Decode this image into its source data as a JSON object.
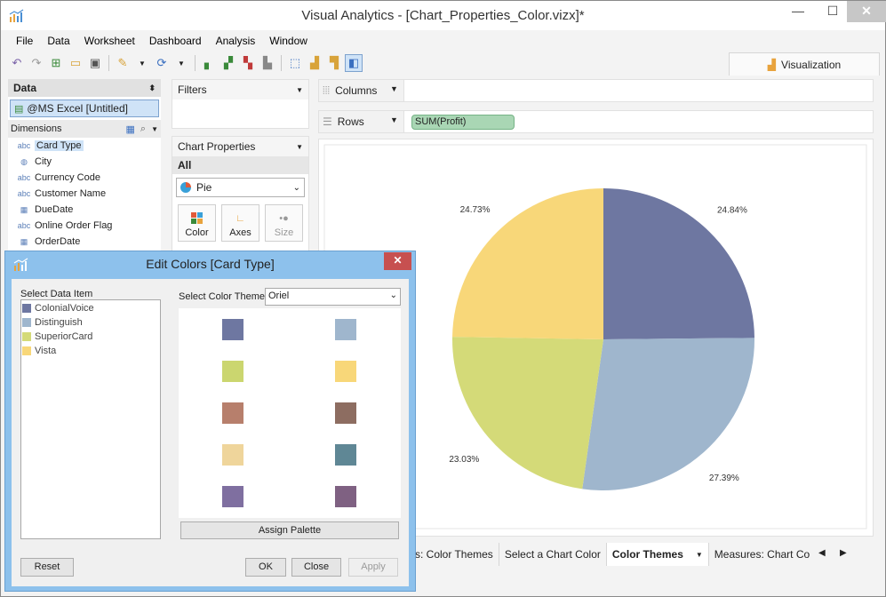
{
  "window": {
    "title": "Visual Analytics - [Chart_Properties_Color.vizx]*"
  },
  "menu": [
    "File",
    "Data",
    "Worksheet",
    "Dashboard",
    "Analysis",
    "Window"
  ],
  "visualization_tab": "Visualization",
  "data_pane": {
    "header": "Data",
    "datasource": "@MS Excel [Untitled]",
    "dimensions_label": "Dimensions",
    "dimensions": [
      {
        "type": "abc",
        "label": "Card Type",
        "selected": true
      },
      {
        "type": "globe",
        "label": "City"
      },
      {
        "type": "abc",
        "label": "Currency Code"
      },
      {
        "type": "abc",
        "label": "Customer Name"
      },
      {
        "type": "date",
        "label": "DueDate"
      },
      {
        "type": "abc",
        "label": "Online Order Flag"
      },
      {
        "type": "date",
        "label": "OrderDate"
      }
    ],
    "type_glyphs": {
      "abc": "abc",
      "globe": "◍",
      "date": "▦"
    }
  },
  "filters": {
    "label": "Filters"
  },
  "chart_properties": {
    "label": "Chart Properties",
    "all": "All",
    "chart_type": "Pie",
    "buttons": [
      "Color",
      "Axes",
      "Size"
    ]
  },
  "shelves": {
    "columns_label": "Columns",
    "rows_label": "Rows",
    "rows_pill": "SUM(Profit)"
  },
  "chart_data": {
    "type": "pie",
    "categories": [
      "ColonialVoice",
      "Distinguish",
      "SuperiorCard",
      "Vista"
    ],
    "values": [
      24.84,
      27.39,
      23.03,
      24.73
    ],
    "labels": [
      "24.84%",
      "27.39%",
      "23.03%",
      "24.73%"
    ],
    "colors": [
      "#6e77a1",
      "#9fb6cd",
      "#d4da78",
      "#f8d779"
    ]
  },
  "sheet_tabs": [
    "s: Color Themes",
    "Select a Chart Color",
    "Color Themes",
    "Measures: Chart Color"
  ],
  "active_tab": "Color Themes",
  "dialog": {
    "title": "Edit Colors [Card Type]",
    "select_data_item_label": "Select Data Item",
    "items": [
      {
        "label": "ColonialVoice",
        "color": "#6e77a1"
      },
      {
        "label": "Distinguish",
        "color": "#9fb6cd"
      },
      {
        "label": "SuperiorCard",
        "color": "#d4da78"
      },
      {
        "label": "Vista",
        "color": "#f8d779"
      }
    ],
    "theme_label": "Select Color Theme:",
    "theme_value": "Oriel",
    "palette": [
      "#6e77a1",
      "#9fb6cd",
      "#cbd66f",
      "#f8d779",
      "#b77f6c",
      "#8d6d61",
      "#efd59b",
      "#5f8795",
      "#7f6fa0",
      "#7f6182"
    ],
    "assign_palette": "Assign Palette",
    "reset": "Reset",
    "ok": "OK",
    "close": "Close",
    "apply": "Apply"
  }
}
